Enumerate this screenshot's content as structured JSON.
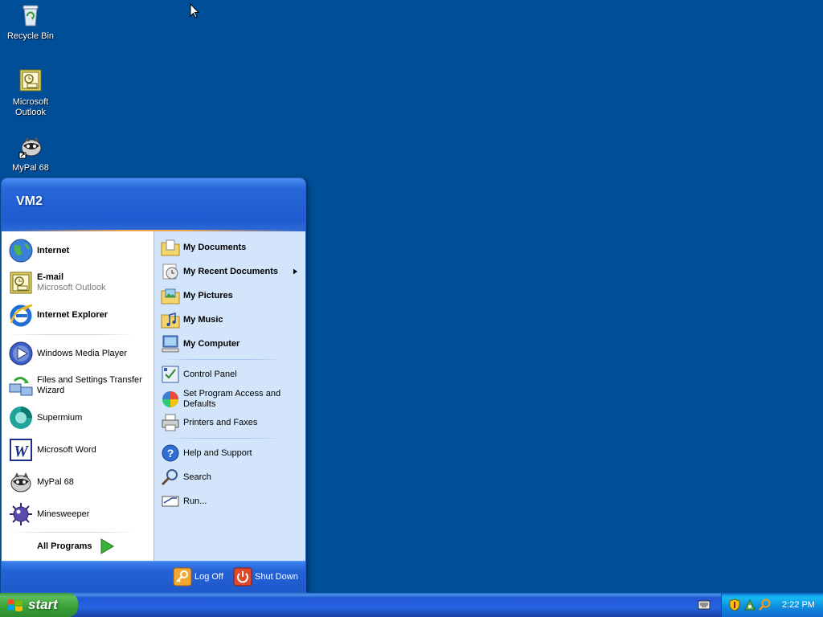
{
  "desktop": {
    "icons": [
      {
        "label": "Recycle Bin",
        "icon": "recycle-bin-icon"
      },
      {
        "label": "Microsoft Outlook",
        "icon": "outlook-icon"
      },
      {
        "label": "MyPal 68",
        "icon": "mypal-icon"
      }
    ]
  },
  "start_menu": {
    "user_name": "VM2",
    "pinned": [
      {
        "label": "Internet",
        "icon": "globe-icon"
      },
      {
        "label": "E-mail",
        "sub": "Microsoft Outlook",
        "icon": "outlook-icon"
      }
    ],
    "pinned_plain": [
      {
        "label": "Internet Explorer",
        "icon": "internet-explorer-icon"
      }
    ],
    "recent": [
      {
        "label": "Windows Media Player",
        "icon": "media-player-icon"
      },
      {
        "label": "Files and Settings Transfer Wizard",
        "icon": "transfer-wizard-icon"
      },
      {
        "label": "Supermium",
        "icon": "supermium-icon"
      },
      {
        "label": "Microsoft Word",
        "icon": "word-icon"
      },
      {
        "label": "MyPal 68",
        "icon": "mypal-icon"
      },
      {
        "label": "Minesweeper",
        "icon": "minesweeper-icon"
      }
    ],
    "all_programs": "All Programs",
    "places": [
      {
        "label": "My Documents",
        "icon": "folder-documents-icon"
      },
      {
        "label": "My Recent Documents",
        "icon": "recent-documents-icon"
      },
      {
        "label": "My Pictures",
        "icon": "folder-pictures-icon"
      },
      {
        "label": "My Music",
        "icon": "folder-music-icon"
      },
      {
        "label": "My Computer",
        "icon": "computer-icon"
      }
    ],
    "system": [
      {
        "label": "Control Panel",
        "icon": "control-panel-icon"
      },
      {
        "label": "Set Program Access and Defaults",
        "icon": "program-defaults-icon"
      },
      {
        "label": "Printers and Faxes",
        "icon": "printer-icon"
      }
    ],
    "help": [
      {
        "label": "Help and Support",
        "icon": "help-icon"
      },
      {
        "label": "Search",
        "icon": "search-icon"
      },
      {
        "label": "Run...",
        "icon": "run-icon"
      }
    ],
    "log_off": "Log Off",
    "shut_down": "Shut Down"
  },
  "taskbar": {
    "start_label": "start",
    "clock": "2:22 PM"
  }
}
